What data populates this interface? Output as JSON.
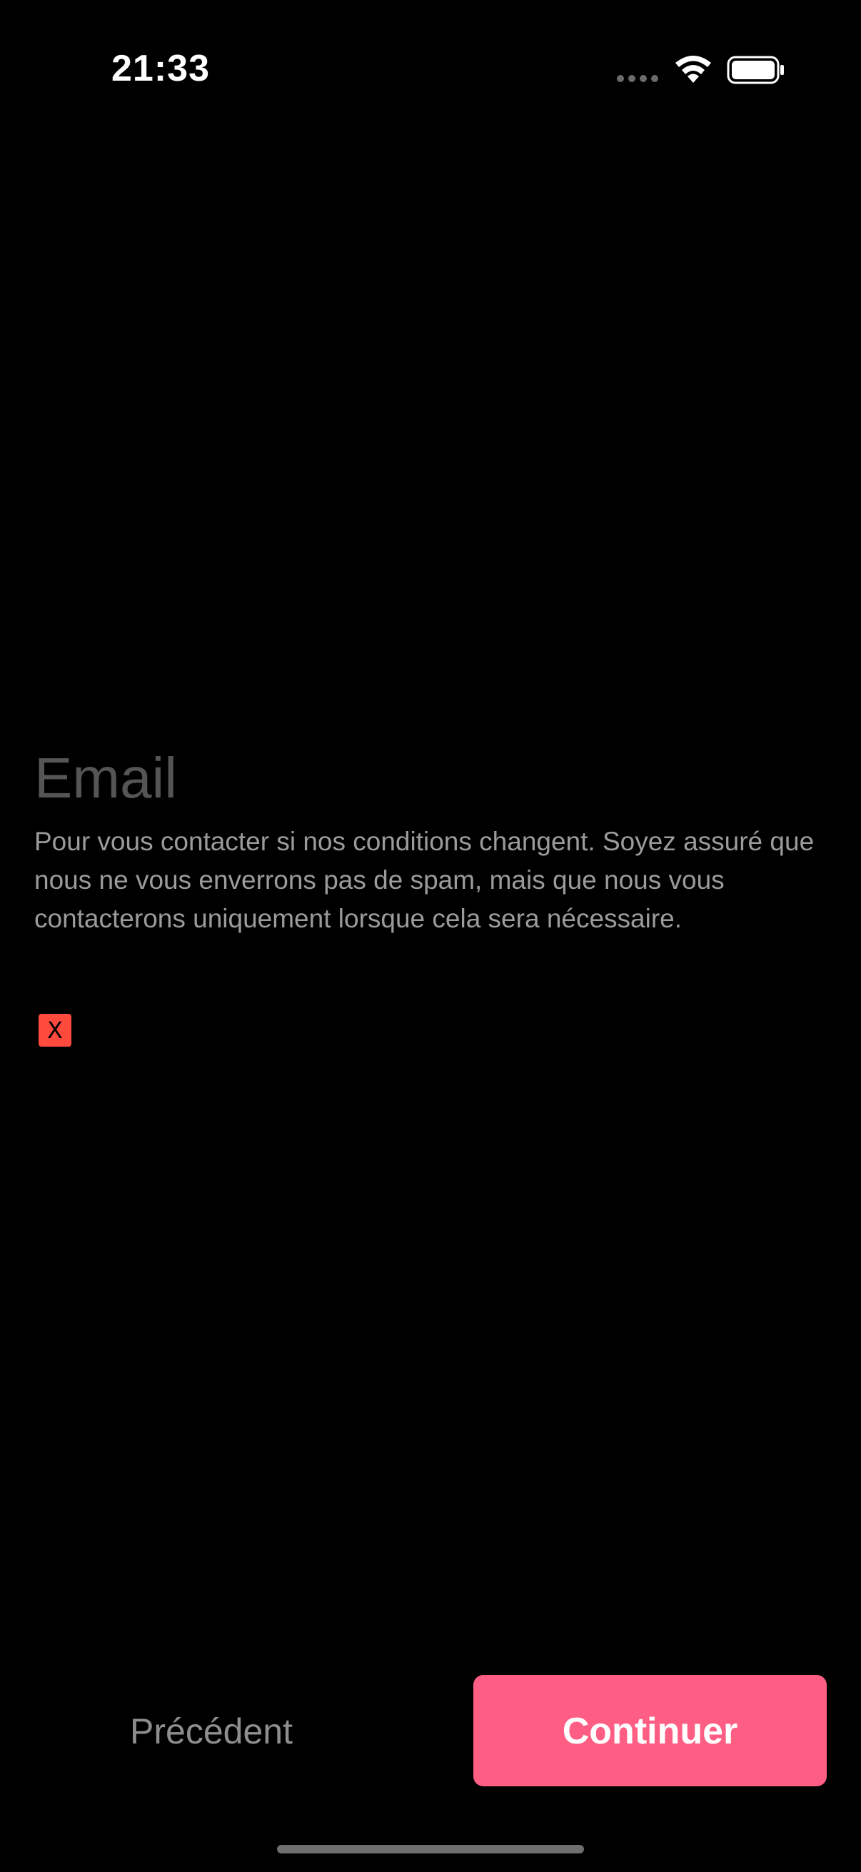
{
  "status_bar": {
    "time": "21:33",
    "icons": [
      "signal-icon",
      "wifi-icon",
      "battery-icon"
    ]
  },
  "form": {
    "title": "Email",
    "description": "Pour vous contacter si nos conditions changent. Soyez assuré que nous ne vous enverrons pas de spam, mais que nous vous contacterons uniquement lorsque cela sera nécessaire.",
    "error_mark": "X"
  },
  "navigation": {
    "back_label": "Précédent",
    "continue_label": "Continuer"
  },
  "colors": {
    "background": "#000000",
    "accent": "#ff5e84",
    "error": "#ff4a3d",
    "title_text": "#555555",
    "body_text": "#9b9b9b"
  }
}
